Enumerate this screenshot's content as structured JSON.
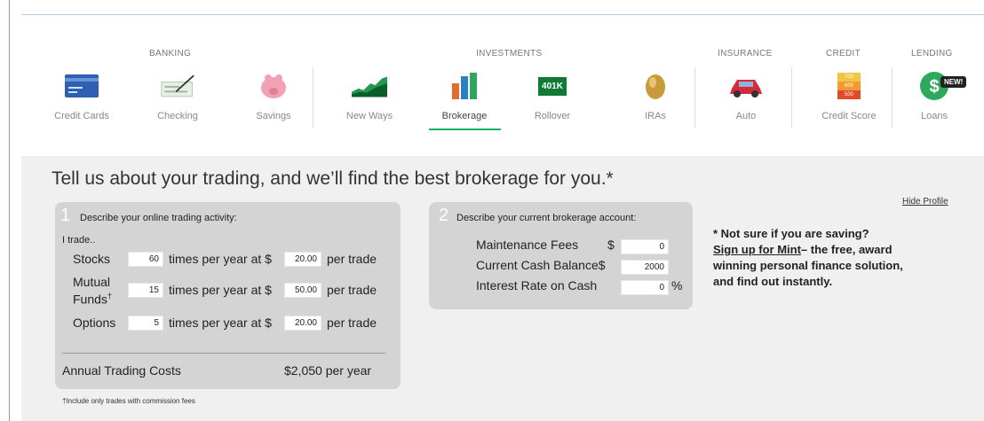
{
  "categories": {
    "banking": "BANKING",
    "investments": "INVESTMENTS",
    "insurance": "INSURANCE",
    "credit": "CREDIT",
    "lending": "LENDING"
  },
  "nav": {
    "credit_cards": "Credit Cards",
    "checking": "Checking",
    "savings": "Savings",
    "new_ways": "New Ways",
    "brokerage": "Brokerage",
    "rollover": "Rollover",
    "iras": "IRAs",
    "auto": "Auto",
    "credit_score": "Credit Score",
    "loans": "Loans",
    "badge_new": "NEW!",
    "rollover_icon_text": "401K",
    "credit_score_icon_values": [
      "700",
      "600",
      "500"
    ]
  },
  "main": {
    "headline": "Tell us about your trading, and we’ll find the best brokerage for you.*",
    "hide_profile": "Hide Profile"
  },
  "panel1": {
    "number": "1",
    "title": "Describe your online trading activity:",
    "intro": "I trade..",
    "rows": [
      {
        "label": "Stocks",
        "count": "60",
        "mid": "times per year at $",
        "price": "20.00",
        "suffix": "per trade"
      },
      {
        "label": "Mutual Funds†",
        "label_line1": "Mutual",
        "label_line2": "Funds",
        "label_sup": "†",
        "count": "15",
        "mid": "times per year at $",
        "price": "50.00",
        "suffix": "per trade"
      },
      {
        "label": "Options",
        "count": "5",
        "mid": "times per year at $",
        "price": "20.00",
        "suffix": "per trade"
      }
    ],
    "total_label": "Annual Trading Costs",
    "total_value": "$2,050 per year",
    "footnote": "†Include only trades with commission fees"
  },
  "panel2": {
    "number": "2",
    "title": "Describe your current brokerage account:",
    "fields": [
      {
        "label": "Maintenance Fees",
        "prefix": "$",
        "value": "0",
        "suffix": ""
      },
      {
        "label": "Current Cash Balance$",
        "prefix": "",
        "value": "2000",
        "suffix": ""
      },
      {
        "label": "Interest Rate on Cash",
        "prefix": "",
        "value": "0",
        "suffix": "%"
      }
    ]
  },
  "side_note": {
    "line1": "* Not sure if you are saving?",
    "link": "Sign up for Mint",
    "rest": "– the free, award winning personal finance solution, and find out instantly."
  },
  "colors": {
    "accent_green": "#1fae6a",
    "panel_gray": "#d4d4d4",
    "background_gray": "#f0f0f0"
  },
  "icons": [
    "credit-card-icon",
    "check-pen-icon",
    "piggy-bank-icon",
    "area-chart-icon",
    "bar-chart-icon",
    "401k-icon",
    "golden-egg-icon",
    "car-icon",
    "credit-meter-icon",
    "dollar-loan-icon"
  ]
}
